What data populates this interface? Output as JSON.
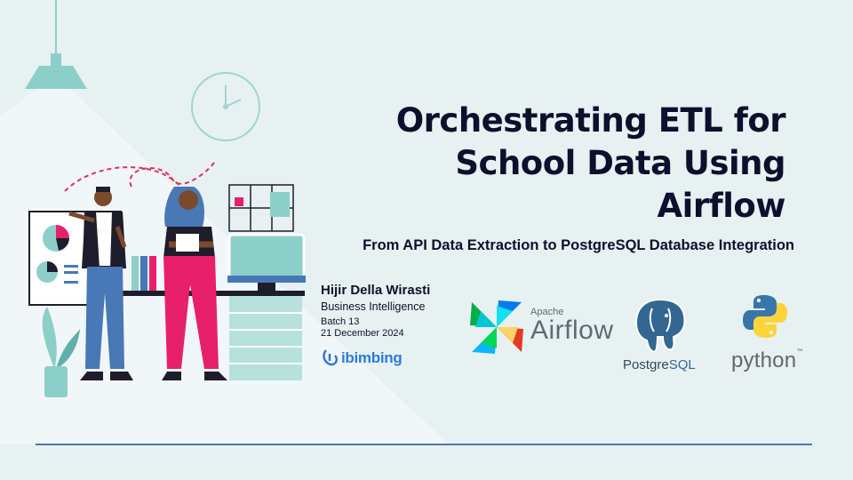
{
  "title": "Orchestrating ETL for School Data Using Airflow",
  "subtitle": "From API Data Extraction to PostgreSQL Database Integration",
  "author": {
    "name": "Hijir Della Wirasti",
    "role": "Business Intelligence",
    "batch": "Batch 13",
    "date": "21 December 2024"
  },
  "brand": "ibimbing",
  "logos": {
    "airflow_apache": "Apache",
    "airflow_name": "Airflow",
    "postgres_a": "Postgre",
    "postgres_b": "SQL",
    "python": "python",
    "python_tm": "™"
  },
  "colors": {
    "background": "#e7f1f2",
    "title": "#0e0f2c",
    "accent_teal": "#8ccfc9",
    "accent_pink": "#e81f6a",
    "rule_line": "#4878b5"
  },
  "icons": [
    "ceiling-lamp-icon",
    "wall-clock-icon",
    "airflow-pinwheel-icon",
    "postgresql-elephant-icon",
    "python-logo-icon",
    "ibimbing-logo-icon"
  ]
}
